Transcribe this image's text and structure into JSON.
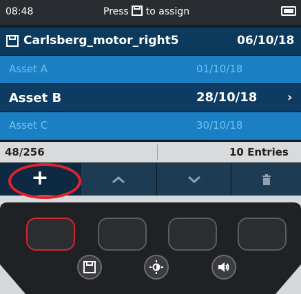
{
  "status_bar": {
    "time": "08:48",
    "hint_prefix": "Press",
    "hint_suffix": "to assign",
    "battery_icon": "battery-icon"
  },
  "file": {
    "name": "Carlsberg_motor_right5",
    "date": "06/10/18",
    "icon": "save-icon"
  },
  "assets": [
    {
      "name": "Asset A",
      "date": "01/10/18",
      "selected": false
    },
    {
      "name": "Asset B",
      "date": "28/10/18",
      "selected": true,
      "chevron": "›"
    },
    {
      "name": "Asset C",
      "date": "30/10/18",
      "selected": false
    }
  ],
  "footer": {
    "count": "48/256",
    "entries": "10 Entries"
  },
  "softkeys": [
    {
      "label": "+",
      "icon": "plus-icon"
    },
    {
      "label": "^",
      "icon": "chevron-up-icon"
    },
    {
      "label": "v",
      "icon": "chevron-down-icon"
    },
    {
      "label": "",
      "icon": "trash-icon"
    }
  ],
  "hardware": {
    "round_buttons": [
      "save-icon",
      "brightness-icon",
      "volume-icon"
    ]
  },
  "colors": {
    "highlight_ring": "#e1232e",
    "row_dim": "#1b7fc4",
    "row_selected": "#0d3b61"
  }
}
